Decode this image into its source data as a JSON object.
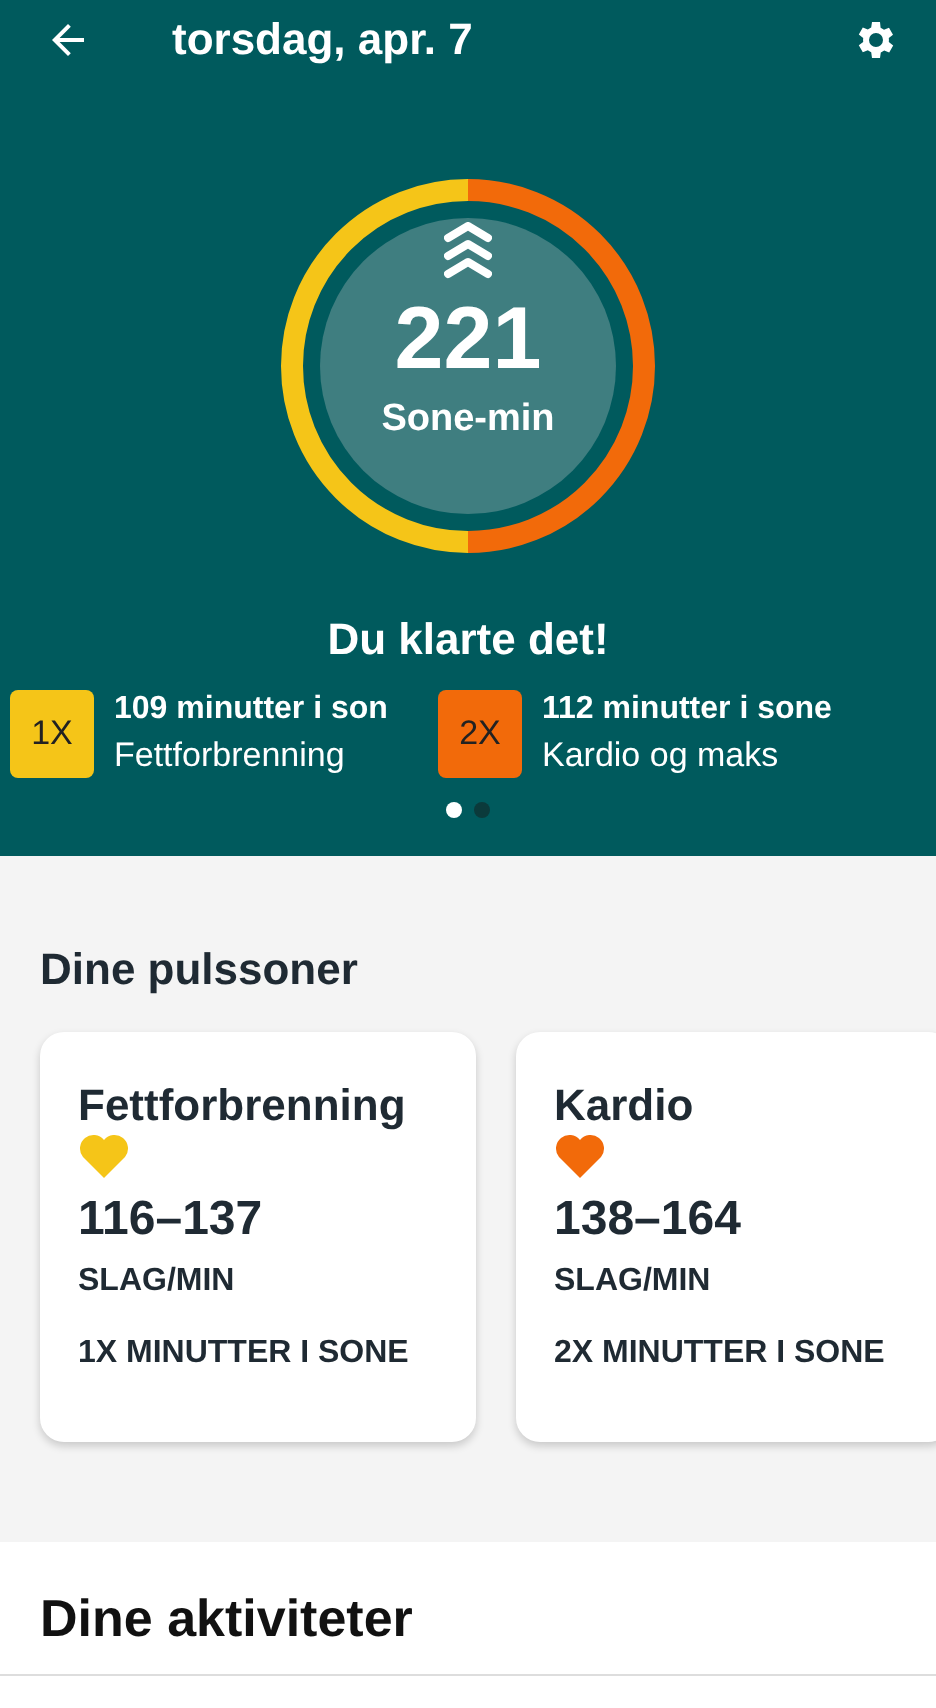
{
  "header": {
    "title": "torsdag, apr. 7"
  },
  "ring": {
    "value": "221",
    "unit": "Sone-min",
    "segments": [
      {
        "color": "#f5c518"
      },
      {
        "color": "#f26a0a"
      }
    ]
  },
  "message": "Du klarte det!",
  "zone_summary": [
    {
      "badge": "1X",
      "color": "#f5c518",
      "minutes": "109 minutter i son",
      "zone": "Fettforbrenning"
    },
    {
      "badge": "2X",
      "color": "#f26a0a",
      "minutes": "112 minutter i sone",
      "zone": "Kardio og maks"
    }
  ],
  "pager": [
    {
      "selected": true
    },
    {
      "selected": false
    }
  ],
  "heart_zones": {
    "title": "Dine pulssoner",
    "cards": [
      {
        "name": "Fettforbrenning",
        "color": "#f5c518",
        "range": "116–137",
        "unit": "SLAG/MIN",
        "multiplier": "1X MINUTTER I SONE"
      },
      {
        "name": "Kardio",
        "color": "#f26a0a",
        "range": "138–164",
        "unit": "SLAG/MIN",
        "multiplier": "2X MINUTTER I SONE"
      }
    ]
  },
  "activities": {
    "title": "Dine aktiviteter"
  }
}
